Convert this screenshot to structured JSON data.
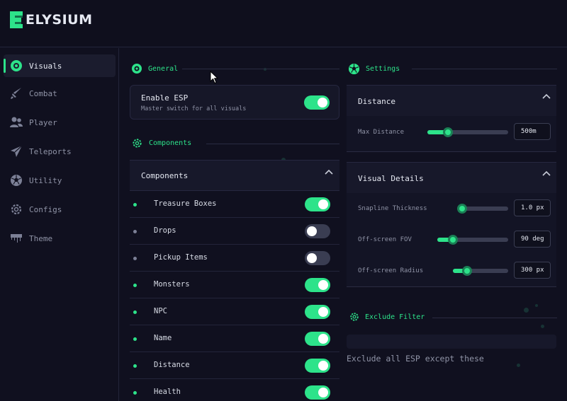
{
  "app": {
    "name": "ELYSIUM"
  },
  "colors": {
    "accent": "#2de38a",
    "background": "#10101f",
    "panel": "#161728",
    "muted": "#8f93a6"
  },
  "sidebar": {
    "items": [
      {
        "label": "Visuals",
        "icon": "eye-ring-icon",
        "active": true
      },
      {
        "label": "Combat",
        "icon": "sword-icon",
        "active": false
      },
      {
        "label": "Player",
        "icon": "users-icon",
        "active": false
      },
      {
        "label": "Teleports",
        "icon": "paper-plane-icon",
        "active": false
      },
      {
        "label": "Utility",
        "icon": "soccer-ball-icon",
        "active": false
      },
      {
        "label": "Configs",
        "icon": "gear-icon",
        "active": false
      },
      {
        "label": "Theme",
        "icon": "paint-drip-icon",
        "active": false
      }
    ]
  },
  "general": {
    "title": "General",
    "enable_esp": {
      "label": "Enable ESP",
      "description": "Master switch for all visuals",
      "on": true
    }
  },
  "components": {
    "section_title": "Components",
    "panel_title": "Components",
    "items": [
      {
        "label": "Treasure Boxes",
        "on": true
      },
      {
        "label": "Drops",
        "on": false
      },
      {
        "label": "Pickup Items",
        "on": false
      },
      {
        "label": "Monsters",
        "on": true
      },
      {
        "label": "NPC",
        "on": true
      },
      {
        "label": "Name",
        "on": true
      },
      {
        "label": "Distance",
        "on": true
      },
      {
        "label": "Health",
        "on": true
      }
    ]
  },
  "settings": {
    "title": "Settings",
    "distance": {
      "title": "Distance",
      "max_distance": {
        "label": "Max Distance",
        "value": "500m",
        "fraction": 0.25
      }
    },
    "visual_details": {
      "title": "Visual Details",
      "snapline_thickness": {
        "label": "Snapline Thickness",
        "value": "1.0 px",
        "fraction": 0.08
      },
      "offscreen_fov": {
        "label": "Off-screen FOV",
        "value": "90 deg",
        "fraction": 0.22
      },
      "offscreen_radius": {
        "label": "Off-screen Radius",
        "value": "300 px",
        "fraction": 0.26
      }
    }
  },
  "exclude_filter": {
    "title": "Exclude Filter",
    "placeholder": "Exclude all ESP except these"
  }
}
